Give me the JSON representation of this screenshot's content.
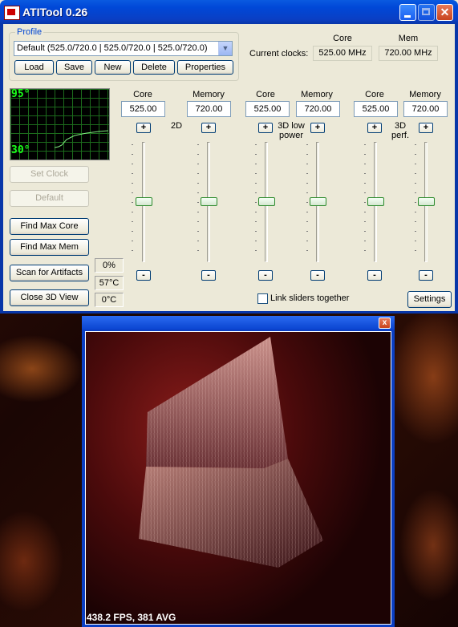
{
  "window": {
    "title": "ATITool 0.26"
  },
  "profile": {
    "group_label": "Profile",
    "selected": "Default (525.0/720.0 | 525.0/720.0 | 525.0/720.0)",
    "buttons": {
      "load": "Load",
      "save": "Save",
      "new": "New",
      "delete": "Delete",
      "properties": "Properties"
    }
  },
  "clocks": {
    "current_label": "Current clocks:",
    "core_header": "Core",
    "mem_header": "Mem",
    "core_value": "525.00 MHz",
    "mem_value": "720.00 MHz"
  },
  "graph": {
    "max_label": "95°",
    "min_label": "30°",
    "line_color": "#7fe87f"
  },
  "columns": [
    {
      "core_label": "Core",
      "mem_label": "Memory",
      "core": "525.00",
      "mem": "720.00",
      "mode": "2D"
    },
    {
      "core_label": "Core",
      "mem_label": "Memory",
      "core": "525.00",
      "mem": "720.00",
      "mode_line1": "3D low",
      "mode_line2": "power"
    },
    {
      "core_label": "Core",
      "mem_label": "Memory",
      "core": "525.00",
      "mem": "720.00",
      "mode_line1": "3D",
      "mode_line2": "perf."
    }
  ],
  "plus": "+",
  "minus": "-",
  "left_buttons": {
    "set_clock": "Set Clock",
    "default": "Default",
    "find_max_core": "Find Max Core",
    "find_max_mem": "Find Max Mem",
    "scan_artifacts": "Scan for Artifacts",
    "close_3d": "Close 3D View"
  },
  "status": {
    "artifacts": "0%",
    "temp": "57°C",
    "delta": "0°C"
  },
  "link_sliders_label": "Link sliders together",
  "settings_label": "Settings",
  "view3d": {
    "fps_text": "438.2 FPS, 381 AVG",
    "close_glyph": "x"
  },
  "colors": {
    "title_blue": "#0a46d8",
    "accent_text": "#0046d5",
    "graph_green": "#1aff1a"
  }
}
